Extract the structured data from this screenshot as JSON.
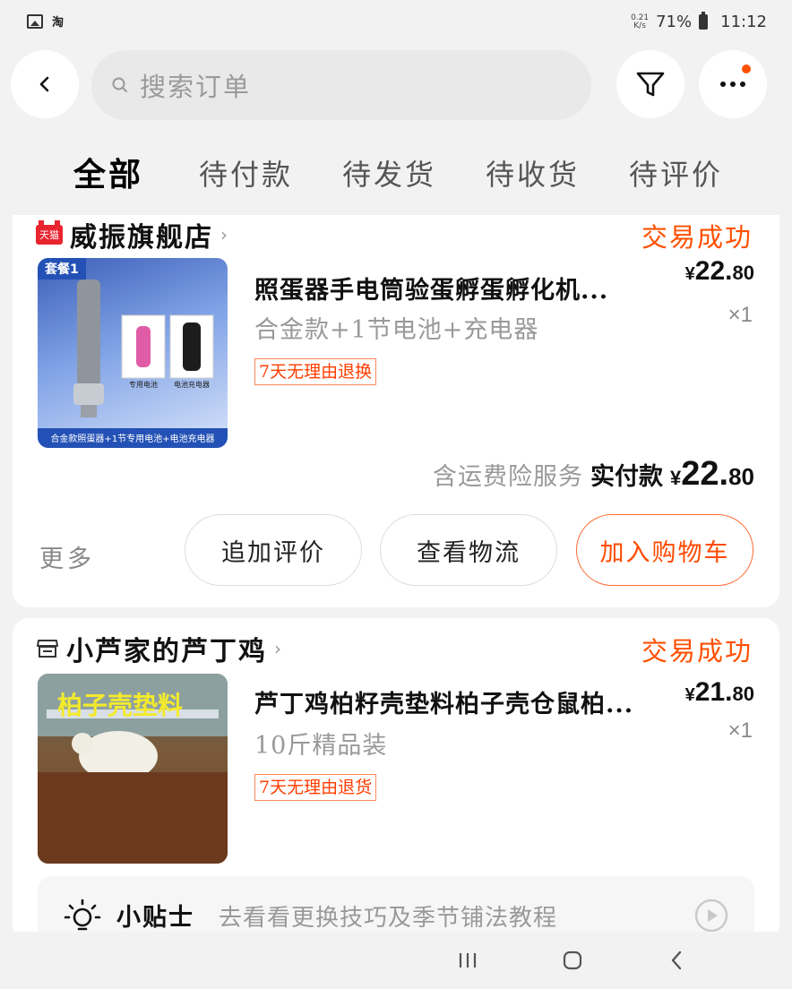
{
  "status_bar": {
    "left_app_label": "淘",
    "net_speed_value": "0.21",
    "net_speed_unit": "K/s",
    "battery": "71%",
    "time": "11:12"
  },
  "search": {
    "placeholder": "搜索订单"
  },
  "tabs": [
    {
      "label": "全部",
      "active": true
    },
    {
      "label": "待付款"
    },
    {
      "label": "待发货"
    },
    {
      "label": "待收货"
    },
    {
      "label": "待评价"
    }
  ],
  "orders": [
    {
      "store_badge": "天猫",
      "store": "威振旗舰店",
      "status": "交易成功",
      "thumb_banner": "套餐1",
      "thumb_label_battery": "专用电池",
      "thumb_label_charger": "电池充电器",
      "thumb_caption": "合金款照蛋器+1节专用电池+电池充电器",
      "title": "照蛋器手电筒验蛋孵蛋孵化机...",
      "spec": "合金款+1节电池+充电器",
      "tag": "7天无理由退换",
      "price_currency": "¥",
      "price_int": "22.",
      "price_dec": "80",
      "qty": "×1",
      "paid_note": "含运费险服务",
      "paid_label": "实付款",
      "paid_currency": "¥",
      "paid_int": "22.",
      "paid_dec": "80",
      "more": "更多",
      "actions": [
        "追加评价",
        "查看物流",
        "加入购物车"
      ]
    },
    {
      "store": "小芦家的芦丁鸡",
      "status": "交易成功",
      "thumb_text": "柏子壳垫料",
      "title": "芦丁鸡柏籽壳垫料柏子壳仓鼠柏...",
      "spec": "10斤精品装",
      "tag": "7天无理由退货",
      "price_currency": "¥",
      "price_int": "21.",
      "price_dec": "80",
      "qty": "×1",
      "tips_label": "小贴士",
      "tips_text": "去看看更换技巧及季节铺法教程"
    }
  ],
  "colors": {
    "accent": "#ff5000",
    "tmall_red": "#e8242f"
  }
}
